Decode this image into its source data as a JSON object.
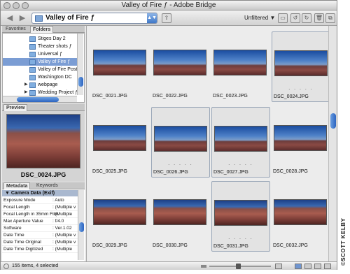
{
  "window": {
    "title": "Valley of Fire ƒ - Adobe Bridge"
  },
  "toolbar": {
    "look_in": "Valley of Fire ƒ",
    "filter": "Unfiltered",
    "back_symbol": "◀",
    "forward_symbol": "▶",
    "updown_symbol": "▲▼",
    "filter_arrow": "▼"
  },
  "left_tabs": {
    "favorites": "Favorites",
    "folders": "Folders"
  },
  "folders": [
    {
      "label": "Stiges Day 2",
      "selected": false,
      "expander": ""
    },
    {
      "label": "Theater shots ƒ",
      "selected": false,
      "expander": ""
    },
    {
      "label": "Universal ƒ",
      "selected": false,
      "expander": ""
    },
    {
      "label": "Valley of Fire ƒ",
      "selected": true,
      "expander": ""
    },
    {
      "label": "Valley of Fire Poster",
      "selected": false,
      "expander": ""
    },
    {
      "label": "Washington DC",
      "selected": false,
      "expander": ""
    },
    {
      "label": "webpage",
      "selected": false,
      "expander": "▶"
    },
    {
      "label": "Wedding Project ƒ",
      "selected": false,
      "expander": "▶"
    }
  ],
  "preview": {
    "tab": "Preview",
    "filename": "DSC_0024.JPG"
  },
  "metadata_tabs": {
    "metadata": "Metadata",
    "keywords": "Keywords"
  },
  "metadata": {
    "section": "▼ Camera Data (Exif)",
    "rows": [
      {
        "key": "Exposure Mode",
        "value": ": Auto"
      },
      {
        "key": "Focal Length",
        "value": ": (Multiple v"
      },
      {
        "key": "Focal Length in 35mm Film",
        "value": ": (Multiple"
      },
      {
        "key": "Max Aperture Value",
        "value": ": f/4.0"
      },
      {
        "key": "Software",
        "value": ": Ver.1.02"
      },
      {
        "key": "Date Time",
        "value": ": (Multiple v"
      },
      {
        "key": "Date Time Original",
        "value": ": (Multiple v"
      },
      {
        "key": "Date Time Digitized",
        "value": ": (Multiple"
      }
    ]
  },
  "grid": [
    {
      "name": "DSC_0021.JPG",
      "selected": false
    },
    {
      "name": "DSC_0022.JPG",
      "selected": false
    },
    {
      "name": "DSC_0023.JPG",
      "selected": false
    },
    {
      "name": "DSC_0024.JPG",
      "selected": true
    },
    {
      "name": "DSC_0025.JPG",
      "selected": false
    },
    {
      "name": "DSC_0026.JPG",
      "selected": true
    },
    {
      "name": "DSC_0027.JPG",
      "selected": true
    },
    {
      "name": "DSC_0028.JPG",
      "selected": false
    },
    {
      "name": "DSC_0029.JPG",
      "selected": false
    },
    {
      "name": "DSC_0030.JPG",
      "selected": false
    },
    {
      "name": "DSC_0031.JPG",
      "selected": true
    },
    {
      "name": "DSC_0032.JPG",
      "selected": false
    }
  ],
  "rating_dots": ". . . . .",
  "status": {
    "text": "155 items, 4 selected"
  },
  "credit": "©SCOTT KELBY",
  "colors": {
    "selection": "#7b9dd4",
    "accent": "#2c64c0"
  }
}
